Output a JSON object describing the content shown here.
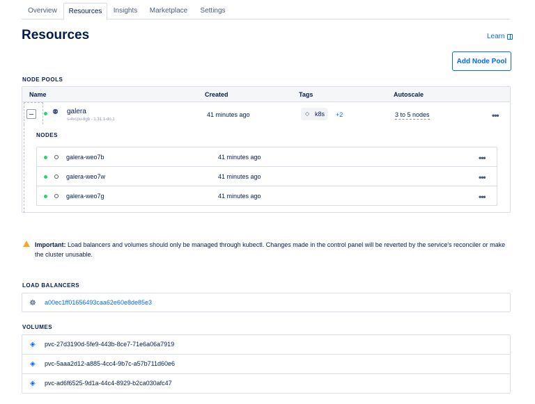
{
  "tabs": [
    {
      "label": "Overview",
      "active": false
    },
    {
      "label": "Resources",
      "active": true
    },
    {
      "label": "Insights",
      "active": false
    },
    {
      "label": "Marketplace",
      "active": false
    },
    {
      "label": "Settings",
      "active": false
    }
  ],
  "page": {
    "title": "Resources",
    "learn_label": "Learn",
    "add_node_pool_label": "Add Node Pool"
  },
  "node_pools": {
    "section_label": "NODE POOLS",
    "columns": [
      "Name",
      "Created",
      "Tags",
      "Autoscale"
    ],
    "pool": {
      "name": "galera",
      "size": "s-4vcpu-8gb - 1.31.1-do.1",
      "created": "41 minutes ago",
      "tag": "k8s",
      "tag_more": "+2",
      "autoscale": "3 to 5 nodes",
      "status_color": "#1fd86b"
    },
    "nodes_label": "NODES",
    "nodes": [
      {
        "name": "galera-weo7b",
        "created": "41 minutes ago"
      },
      {
        "name": "galera-weo7w",
        "created": "41 minutes ago"
      },
      {
        "name": "galera-weo7g",
        "created": "41 minutes ago"
      }
    ]
  },
  "warning": {
    "strong": "Important:",
    "text": " Load balancers and volumes should only be managed through kubectl. Changes made in the control panel will be reverted by the service's reconciler or make the cluster unusable."
  },
  "load_balancers": {
    "section_label": "LOAD BALANCERS",
    "items": [
      "a00ec1ff01656493caa62e60e8de85e3"
    ]
  },
  "volumes": {
    "section_label": "VOLUMES",
    "items": [
      "pvc-27d3190d-5fe9-443b-8ce7-71e6a06a7919",
      "pvc-5aaa2d12-a885-4cc4-9b7c-a57b711d60e6",
      "pvc-ad6f6525-9d1a-44c4-8929-b2ca030afc47"
    ]
  },
  "colors": {
    "accent": "#0069ff",
    "text": "#031b4e",
    "warning": "#f5a623",
    "status_running": "#1fd86b"
  }
}
